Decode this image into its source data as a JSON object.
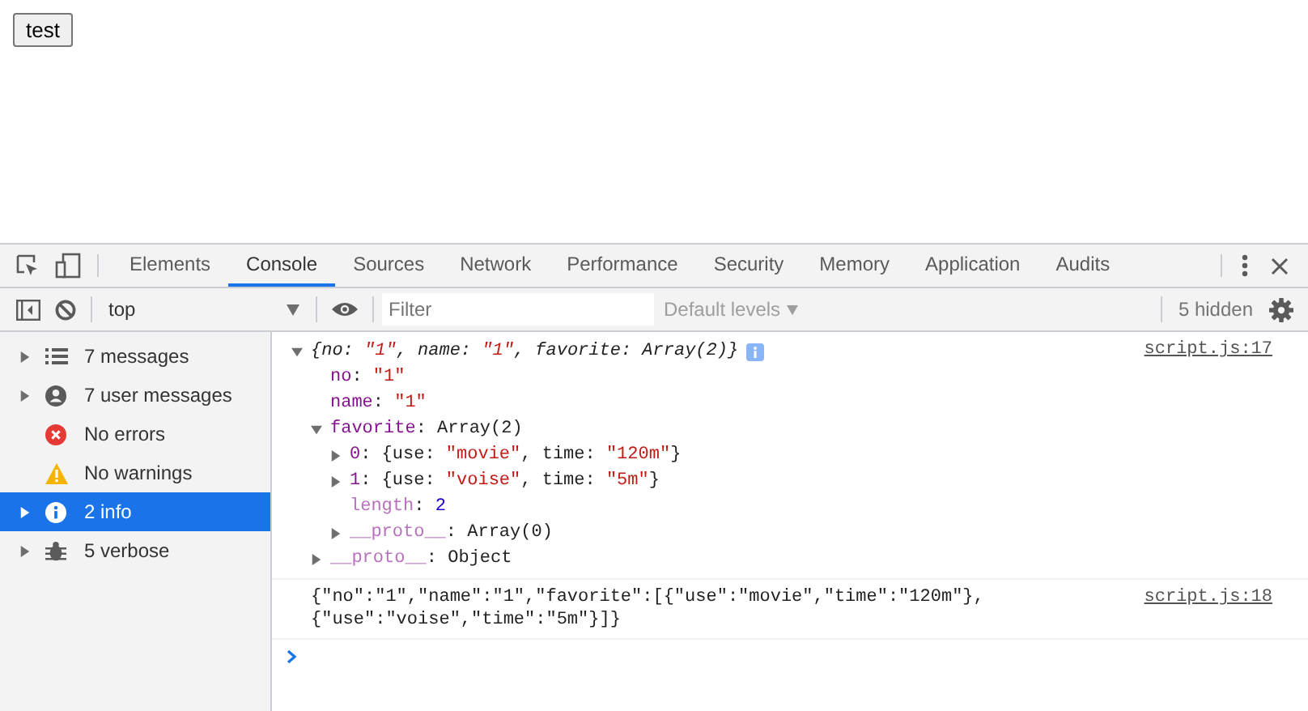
{
  "page": {
    "button": "test"
  },
  "devtools": {
    "tabs": [
      {
        "label": "Elements",
        "selected": false
      },
      {
        "label": "Console",
        "selected": true
      },
      {
        "label": "Sources",
        "selected": false
      },
      {
        "label": "Network",
        "selected": false
      },
      {
        "label": "Performance",
        "selected": false
      },
      {
        "label": "Security",
        "selected": false
      },
      {
        "label": "Memory",
        "selected": false
      },
      {
        "label": "Application",
        "selected": false
      },
      {
        "label": "Audits",
        "selected": false
      }
    ],
    "toolbar": {
      "context": "top",
      "filter": {
        "placeholder": "Filter"
      },
      "levels": "Default levels",
      "hidden": "5 hidden"
    },
    "sidebar": {
      "items": [
        {
          "kind": "messages",
          "label": "7 messages",
          "expanded": false,
          "selected": false
        },
        {
          "kind": "user",
          "label": "7 user messages",
          "expanded": false,
          "selected": false
        },
        {
          "kind": "error",
          "label": "No errors",
          "selected": false
        },
        {
          "kind": "warning",
          "label": "No warnings",
          "selected": false
        },
        {
          "kind": "info",
          "label": "2 info",
          "expanded": false,
          "selected": true
        },
        {
          "kind": "verbose",
          "label": "5 verbose",
          "expanded": false,
          "selected": false
        }
      ]
    },
    "messages": [
      {
        "kind": "tree",
        "source": "script.js:17",
        "tree": {
          "expanded": true,
          "italic": true,
          "badge": true,
          "tokens": [
            {
              "text": "{no: ",
              "kind": "plain"
            },
            {
              "text": "\"1\"",
              "kind": "string"
            },
            {
              "text": ", name: ",
              "kind": "plain"
            },
            {
              "text": "\"1\"",
              "kind": "string"
            },
            {
              "text": ", favorite: Array(2)}",
              "kind": "plain"
            }
          ],
          "children": [
            {
              "tokens": [
                {
                  "text": "no",
                  "kind": "key"
                },
                {
                  "text": ": ",
                  "kind": "plain"
                },
                {
                  "text": "\"1\"",
                  "kind": "string"
                }
              ]
            },
            {
              "tokens": [
                {
                  "text": "name",
                  "kind": "key"
                },
                {
                  "text": ": ",
                  "kind": "plain"
                },
                {
                  "text": "\"1\"",
                  "kind": "string"
                }
              ]
            },
            {
              "expanded": true,
              "tokens": [
                {
                  "text": "favorite",
                  "kind": "key"
                },
                {
                  "text": ": Array(2)",
                  "kind": "plain"
                }
              ],
              "children": [
                {
                  "expanded": false,
                  "tokens": [
                    {
                      "text": "0",
                      "kind": "key"
                    },
                    {
                      "text": ": {use: ",
                      "kind": "plain"
                    },
                    {
                      "text": "\"movie\"",
                      "kind": "string"
                    },
                    {
                      "text": ", time: ",
                      "kind": "plain"
                    },
                    {
                      "text": "\"120m\"",
                      "kind": "string"
                    },
                    {
                      "text": "}",
                      "kind": "plain"
                    }
                  ]
                },
                {
                  "expanded": false,
                  "tokens": [
                    {
                      "text": "1",
                      "kind": "key"
                    },
                    {
                      "text": ": {use: ",
                      "kind": "plain"
                    },
                    {
                      "text": "\"voise\"",
                      "kind": "string"
                    },
                    {
                      "text": ", time: ",
                      "kind": "plain"
                    },
                    {
                      "text": "\"5m\"",
                      "kind": "string"
                    },
                    {
                      "text": "}",
                      "kind": "plain"
                    }
                  ]
                },
                {
                  "tokens": [
                    {
                      "text": "length",
                      "kind": "dimkey"
                    },
                    {
                      "text": ": ",
                      "kind": "plain"
                    },
                    {
                      "text": "2",
                      "kind": "number"
                    }
                  ]
                },
                {
                  "expanded": false,
                  "tokens": [
                    {
                      "text": "__proto__",
                      "kind": "dimkey"
                    },
                    {
                      "text": ": Array(0)",
                      "kind": "plain"
                    }
                  ]
                }
              ]
            },
            {
              "expanded": false,
              "tokens": [
                {
                  "text": "__proto__",
                  "kind": "dimkey"
                },
                {
                  "text": ": Object",
                  "kind": "plain"
                }
              ]
            }
          ]
        }
      },
      {
        "kind": "text",
        "source": "script.js:18",
        "lines": [
          "{\"no\":\"1\",\"name\":\"1\",\"favorite\":[{\"use\":\"movie\",\"time\":\"120m\"},",
          "{\"use\":\"voise\",\"time\":\"5m\"}]}"
        ]
      }
    ]
  }
}
